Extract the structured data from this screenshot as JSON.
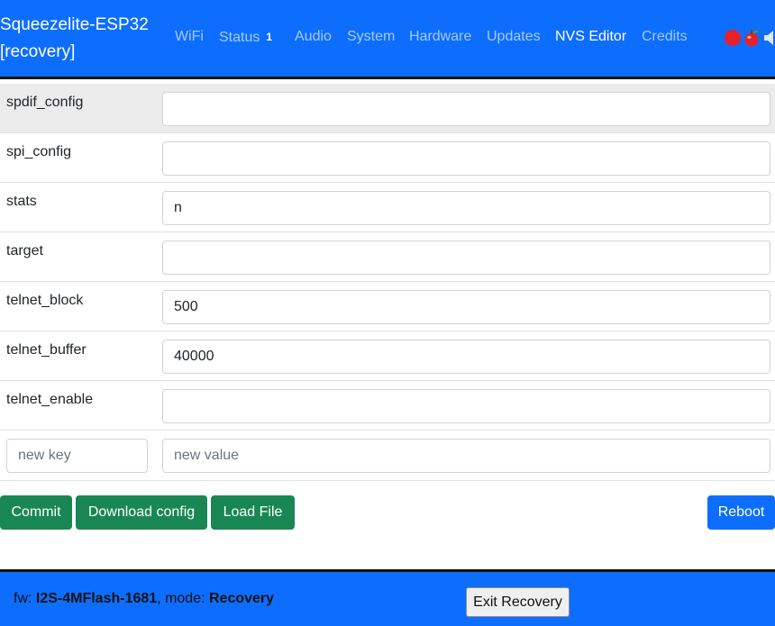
{
  "header": {
    "brand_line1": "Squeezelite-ESP32",
    "brand_line2": "[recovery]",
    "nav": [
      {
        "label": "WiFi"
      },
      {
        "label": "Status",
        "badge": "1"
      },
      {
        "label": "Audio"
      },
      {
        "label": "System"
      },
      {
        "label": "Hardware"
      },
      {
        "label": "Updates"
      },
      {
        "label": "NVS Editor",
        "active": true
      },
      {
        "label": "Credits"
      }
    ],
    "status_icons": [
      "red-dot-icon",
      "apple-icon",
      "speaker-icon"
    ],
    "colors": {
      "background": "#0d6efd",
      "active": "#ffffff",
      "inactive": "rgba(255,255,255,0.62)"
    }
  },
  "nvs": {
    "rows": [
      {
        "key": "spdif_config",
        "value": ""
      },
      {
        "key": "spi_config",
        "value": ""
      },
      {
        "key": "stats",
        "value": "n"
      },
      {
        "key": "target",
        "value": ""
      },
      {
        "key": "telnet_block",
        "value": "500"
      },
      {
        "key": "telnet_buffer",
        "value": "40000"
      },
      {
        "key": "telnet_enable",
        "value": ""
      }
    ],
    "new_key_placeholder": "new key",
    "new_value_placeholder": "new value"
  },
  "actions": {
    "commit": "Commit",
    "download": "Download config",
    "load": "Load File",
    "reboot": "Reboot",
    "colors": {
      "success": "#198754",
      "primary": "#0d6efd"
    }
  },
  "footer": {
    "fw_label": "fw: ",
    "fw_value": "I2S-4MFlash-1681",
    "mode_label": ", mode: ",
    "mode_value": "Recovery",
    "exit_button": "Exit Recovery"
  }
}
